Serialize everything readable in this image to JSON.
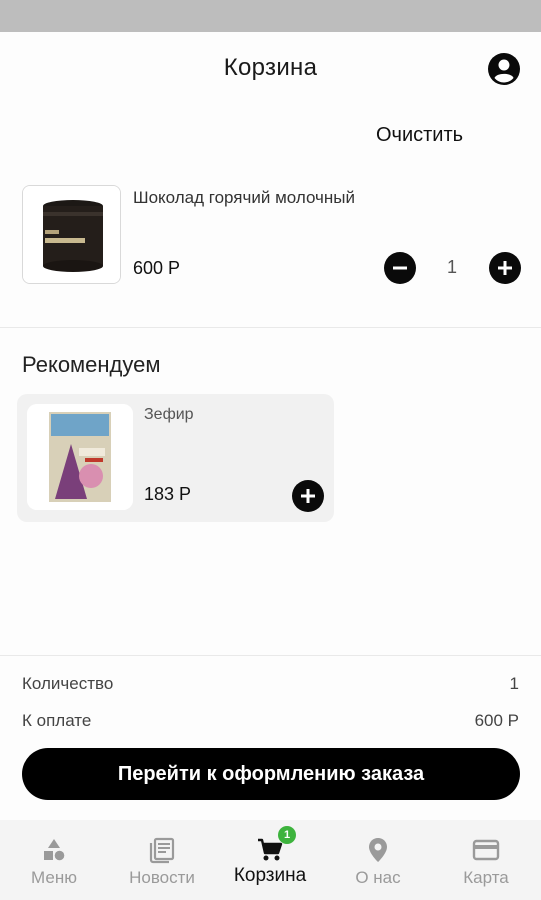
{
  "header": {
    "title": "Корзина"
  },
  "cart": {
    "clear_label": "Очистить",
    "items": [
      {
        "name": "Шоколад горячий молочный",
        "price": "600 Р",
        "quantity": "1"
      }
    ]
  },
  "recommend": {
    "title": "Рекомендуем",
    "items": [
      {
        "name": "Зефир",
        "price": "183 Р"
      }
    ]
  },
  "summary": {
    "quantity_label": "Количество",
    "quantity_value": "1",
    "total_label": "К оплате",
    "total_value": "600 Р"
  },
  "checkout": {
    "label": "Перейти к оформлению заказа"
  },
  "tabbar": {
    "tabs": [
      {
        "label": "Меню",
        "icon": "menu-shapes-icon",
        "active": false
      },
      {
        "label": "Новости",
        "icon": "news-icon",
        "active": false
      },
      {
        "label": "Корзина",
        "icon": "cart-icon",
        "active": true,
        "badge": "1"
      },
      {
        "label": "О нас",
        "icon": "location-pin-icon",
        "active": false
      },
      {
        "label": "Карта",
        "icon": "credit-card-icon",
        "active": false
      }
    ]
  },
  "colors": {
    "accent": "#000000",
    "badge": "#3db33d",
    "inactive_tab": "#9a9a9a"
  }
}
